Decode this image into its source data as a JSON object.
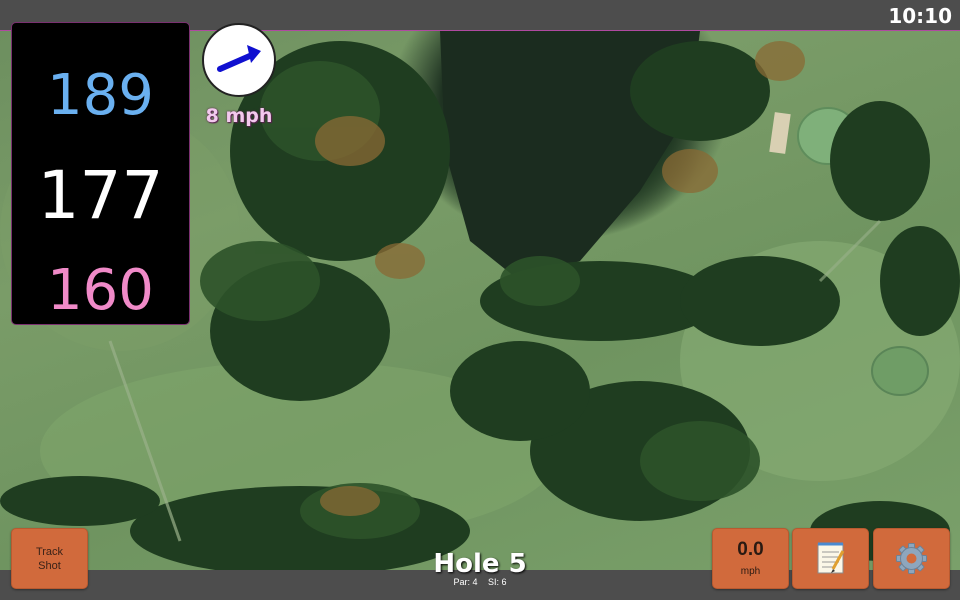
{
  "status": {
    "time": "10:10"
  },
  "distances": {
    "back": "189",
    "middle": "177",
    "front": "160"
  },
  "wind": {
    "speed": "8 mph",
    "direction_icon": "wind-arrow-icon"
  },
  "hole": {
    "title": "Hole 5",
    "par": "Par: 4",
    "si": "SI: 6"
  },
  "buttons": {
    "track_line1": "Track",
    "track_line2": "Shot",
    "speed_value": "0.0",
    "speed_unit": "mph",
    "notes_icon": "notepad-icon",
    "settings_icon": "gear-icon"
  },
  "colors": {
    "back": "#6ab0f0",
    "middle": "#ffffff",
    "front": "#f08ac8",
    "button": "#d16a3c",
    "wind_text": "#f3c9ee"
  }
}
